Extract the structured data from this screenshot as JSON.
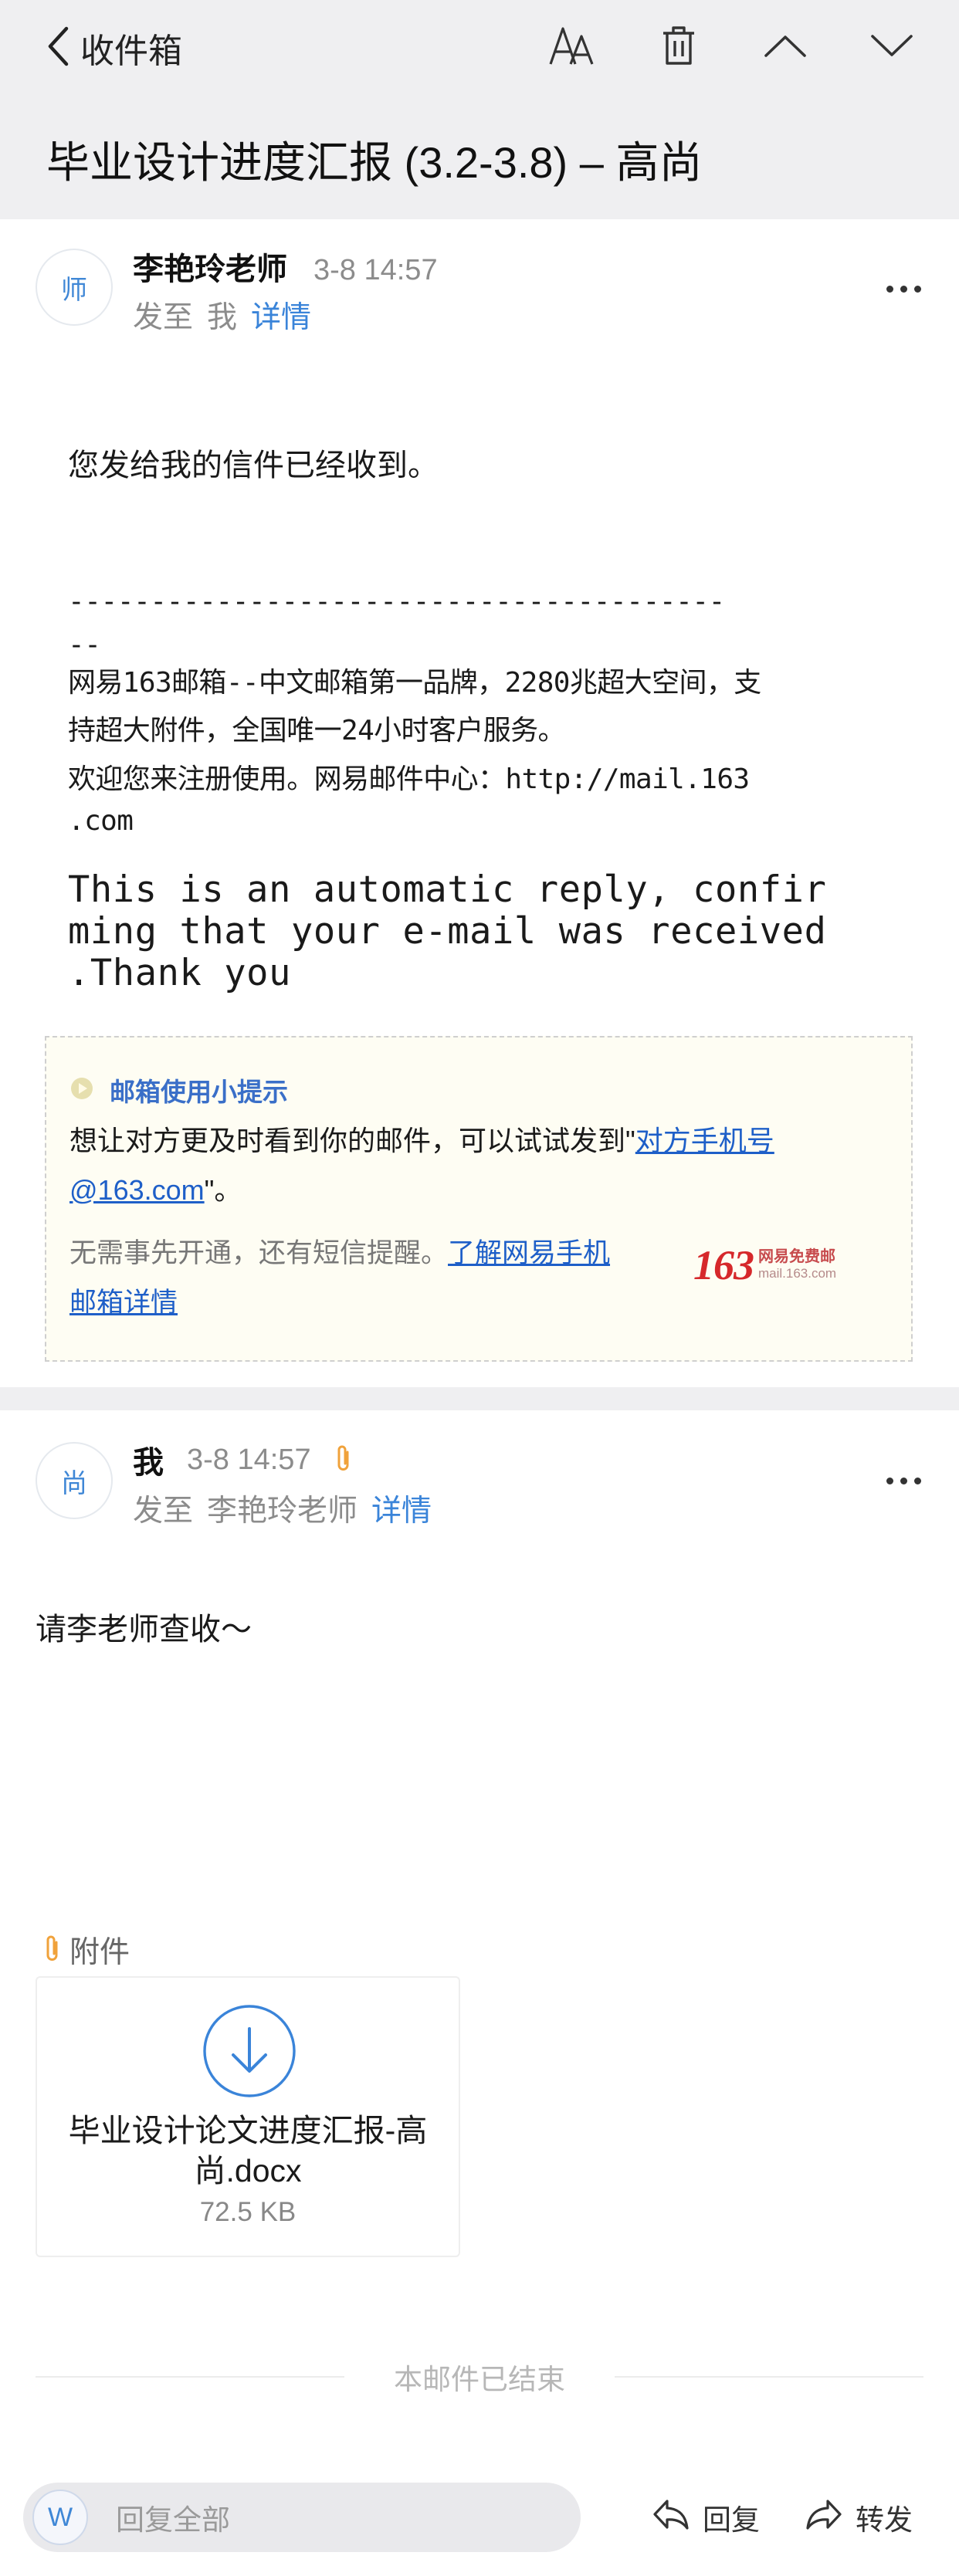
{
  "nav": {
    "back_label": "收件箱"
  },
  "subject": "毕业设计进度汇报 (3.2-3.8) – 高尚",
  "message1": {
    "avatar": "师",
    "sender": "李艳玲老师",
    "time": "3-8 14:57",
    "to_prefix": "发至",
    "to": "我",
    "detail": "详情",
    "body": "您发给我的信件已经收到。",
    "dash_line1": "----------------------------------------",
    "dash_line2": "--",
    "sig_line1": "网易163邮箱--中文邮箱第一品牌，2280兆超大空间，支",
    "sig_line2": "持超大附件，全国唯一24小时客户服务。",
    "sig_line3": "欢迎您来注册使用。网易邮件中心：http://mail.163",
    "sig_line4": ".com",
    "auto_line1": "This is an automatic reply, confir",
    "auto_line2": "ming that your e-mail was received",
    "auto_line3": ".Thank you"
  },
  "tip": {
    "title": "邮箱使用小提示",
    "text_before": "想让对方更及时看到你的邮件，可以试试发到\"",
    "link1_part1": "对方手机号",
    "link1_part2": "@163.com",
    "text_after": "\"。",
    "muted": "无需事先开通，还有短信提醒。",
    "link2_part1": "了解网易手机",
    "link2_part2": "邮箱详情",
    "logo_number": "163",
    "logo_cn": "网易免费邮",
    "logo_url": "mail.163.com"
  },
  "message2": {
    "avatar": "尚",
    "sender": "我",
    "time": "3-8 14:57",
    "to_prefix": "发至",
    "to": "李艳玲老师",
    "detail": "详情",
    "body": "请李老师查收～"
  },
  "attachments": {
    "header": "附件",
    "items": [
      {
        "name_line1": "毕业设计论文进度汇报-高",
        "name_line2": "尚.docx",
        "size": "72.5 KB"
      }
    ]
  },
  "end_text": "本邮件已结束",
  "bottom_bar": {
    "w_badge": "W",
    "reply_placeholder": "回复全部",
    "reply_label": "回复",
    "forward_label": "转发"
  },
  "colors": {
    "accent": "#3a84d9",
    "link": "#1e5fc8",
    "attachment_clip": "#f0a23b",
    "logo_red": "#d6282b",
    "header_bg": "#efeff1"
  },
  "icons": {
    "back": "chevron-left-icon",
    "font_size": "font-size-icon",
    "delete": "trash-icon",
    "previous": "chevron-up-icon",
    "next": "chevron-down-icon",
    "more": "more-dots-icon",
    "attachment": "paperclip-icon",
    "download": "download-icon",
    "reply": "reply-icon",
    "forward": "forward-icon",
    "tip": "play-circle-icon"
  }
}
